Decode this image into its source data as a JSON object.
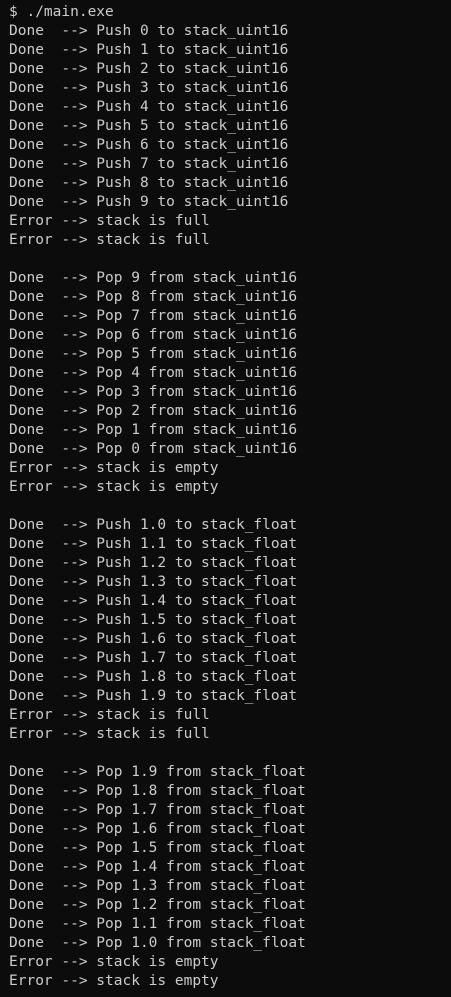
{
  "terminal": {
    "lines": [
      "$ ./main.exe",
      "Done  --> Push 0 to stack_uint16",
      "Done  --> Push 1 to stack_uint16",
      "Done  --> Push 2 to stack_uint16",
      "Done  --> Push 3 to stack_uint16",
      "Done  --> Push 4 to stack_uint16",
      "Done  --> Push 5 to stack_uint16",
      "Done  --> Push 6 to stack_uint16",
      "Done  --> Push 7 to stack_uint16",
      "Done  --> Push 8 to stack_uint16",
      "Done  --> Push 9 to stack_uint16",
      "Error --> stack is full",
      "Error --> stack is full",
      "",
      "Done  --> Pop 9 from stack_uint16",
      "Done  --> Pop 8 from stack_uint16",
      "Done  --> Pop 7 from stack_uint16",
      "Done  --> Pop 6 from stack_uint16",
      "Done  --> Pop 5 from stack_uint16",
      "Done  --> Pop 4 from stack_uint16",
      "Done  --> Pop 3 from stack_uint16",
      "Done  --> Pop 2 from stack_uint16",
      "Done  --> Pop 1 from stack_uint16",
      "Done  --> Pop 0 from stack_uint16",
      "Error --> stack is empty",
      "Error --> stack is empty",
      "",
      "Done  --> Push 1.0 to stack_float",
      "Done  --> Push 1.1 to stack_float",
      "Done  --> Push 1.2 to stack_float",
      "Done  --> Push 1.3 to stack_float",
      "Done  --> Push 1.4 to stack_float",
      "Done  --> Push 1.5 to stack_float",
      "Done  --> Push 1.6 to stack_float",
      "Done  --> Push 1.7 to stack_float",
      "Done  --> Push 1.8 to stack_float",
      "Done  --> Push 1.9 to stack_float",
      "Error --> stack is full",
      "Error --> stack is full",
      "",
      "Done  --> Pop 1.9 from stack_float",
      "Done  --> Pop 1.8 from stack_float",
      "Done  --> Pop 1.7 from stack_float",
      "Done  --> Pop 1.6 from stack_float",
      "Done  --> Pop 1.5 from stack_float",
      "Done  --> Pop 1.4 from stack_float",
      "Done  --> Pop 1.3 from stack_float",
      "Done  --> Pop 1.2 from stack_float",
      "Done  --> Pop 1.1 from stack_float",
      "Done  --> Pop 1.0 from stack_float",
      "Error --> stack is empty",
      "Error --> stack is empty"
    ]
  },
  "colors": {
    "background": "#0c0c0c",
    "foreground": "#cccccc"
  }
}
